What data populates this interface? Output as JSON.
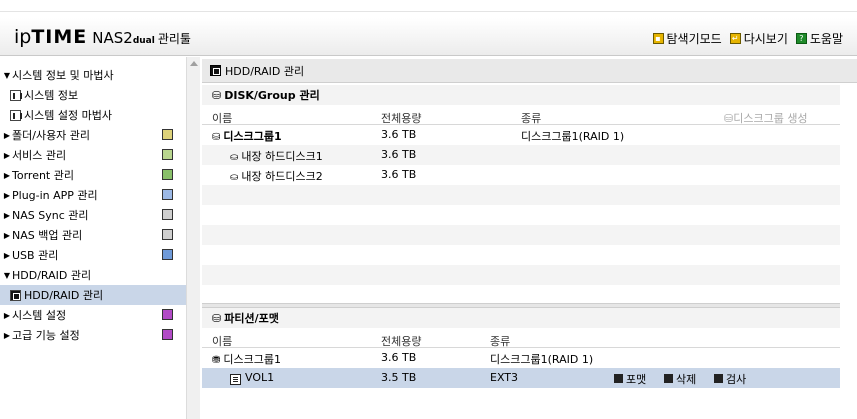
{
  "header": {
    "logo_ip": "ip",
    "logo_time": "TIME",
    "model": "NAS2",
    "model_suffix": "dual",
    "manager": "관리툴",
    "links": [
      {
        "label": "탐색기모드",
        "icon": "explore-icon"
      },
      {
        "label": "다시보기",
        "icon": "reload-icon"
      },
      {
        "label": "도움말",
        "icon": "help-icon"
      }
    ]
  },
  "sidebar": {
    "items": [
      {
        "label": "시스템 정보 및 마법사",
        "expanded": true
      },
      {
        "label": "시스템 정보",
        "sub": true
      },
      {
        "label": "시스템 설정 마법사",
        "sub": true
      },
      {
        "label": "폴더/사용자 관리",
        "expanded": false
      },
      {
        "label": "서비스 관리",
        "expanded": false
      },
      {
        "label": "Torrent 관리",
        "expanded": false
      },
      {
        "label": "Plug-in APP 관리",
        "expanded": false
      },
      {
        "label": "NAS Sync 관리",
        "expanded": false
      },
      {
        "label": "NAS 백업 관리",
        "expanded": false
      },
      {
        "label": "USB 관리",
        "expanded": false
      },
      {
        "label": "HDD/RAID 관리",
        "expanded": true
      },
      {
        "label": "HDD/RAID 관리",
        "sub": true,
        "selected": true
      },
      {
        "label": "시스템 설정",
        "expanded": false
      },
      {
        "label": "고급 기능 설정",
        "expanded": false
      }
    ]
  },
  "main": {
    "title": "HDD/RAID 관리",
    "disk_section": {
      "title": "DISK/Group 관리",
      "columns": [
        "이름",
        "전체용량",
        "종류"
      ],
      "create_label": "디스크그룹 생성",
      "rows": [
        {
          "name": "디스크그룹1",
          "capacity": "3.6 TB",
          "type": "디스크그룹1(RAID 1)"
        },
        {
          "name": "내장 하드디스크1",
          "capacity": "3.6 TB",
          "type": ""
        },
        {
          "name": "내장 하드디스크2",
          "capacity": "3.6 TB",
          "type": ""
        }
      ]
    },
    "partition_section": {
      "title": "파티션/포맷",
      "columns": [
        "이름",
        "전체용량",
        "종류"
      ],
      "rows": [
        {
          "name": "디스크그룹1",
          "capacity": "3.6 TB",
          "type": "디스크그룹1(RAID 1)"
        },
        {
          "name": "VOL1",
          "capacity": "3.5 TB",
          "type": "EXT3"
        }
      ],
      "actions": [
        "포맷",
        "삭제",
        "검사"
      ]
    }
  },
  "colors": {
    "selected_row": "#c9d6e8",
    "header_bg": "#ececec",
    "disabled_text": "#a9a9a9"
  }
}
